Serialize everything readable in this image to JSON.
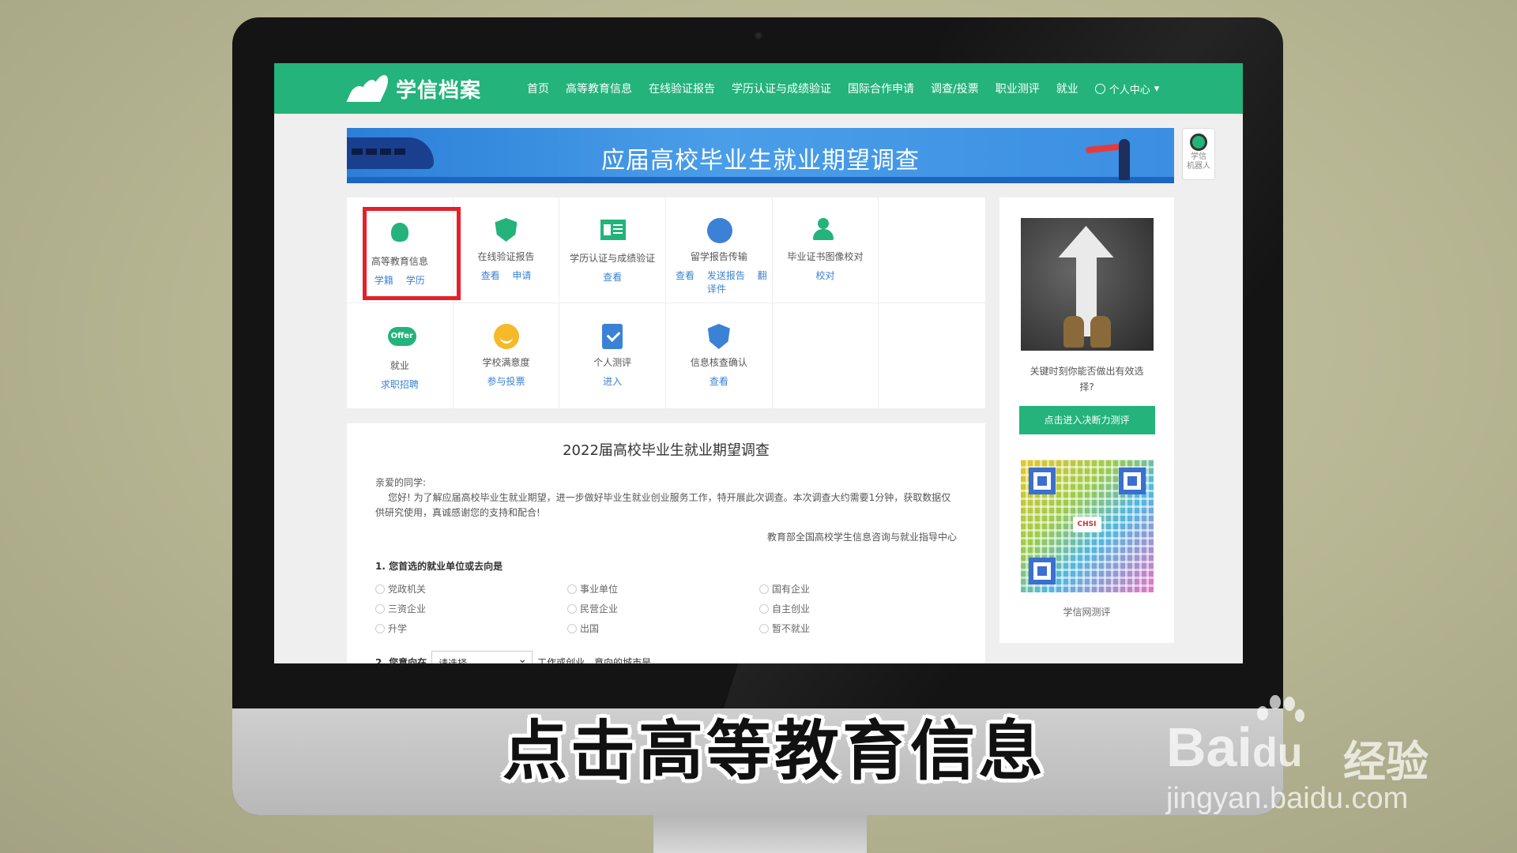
{
  "nav": {
    "logo_text": "学信档案",
    "items": [
      "首页",
      "高等教育信息",
      "在线验证报告",
      "学历认证与成绩验证",
      "国际合作申请",
      "调查/投票",
      "职业测评",
      "就业"
    ],
    "user_menu": "个人中心"
  },
  "banner": {
    "title": "应届高校毕业生就业期望调查"
  },
  "robot": {
    "label_line1": "学信",
    "label_line2": "机器人"
  },
  "services": [
    {
      "name": "高等教育信息",
      "links": [
        "学籍",
        "学历"
      ],
      "icon": "graduate-icon"
    },
    {
      "name": "在线验证报告",
      "links": [
        "查看",
        "申请"
      ],
      "icon": "shield-check-icon"
    },
    {
      "name": "学历认证与成绩验证",
      "links": [
        "查看"
      ],
      "icon": "id-card-icon"
    },
    {
      "name": "留学报告传输",
      "links": [
        "查看",
        "发送报告",
        "翻译件"
      ],
      "icon": "globe-icon"
    },
    {
      "name": "毕业证书图像校对",
      "links": [
        "校对"
      ],
      "icon": "user-check-icon"
    },
    {
      "name": "就业",
      "links": [
        "求职招聘"
      ],
      "icon": "offer-icon"
    },
    {
      "name": "学校满意度",
      "links": [
        "参与投票"
      ],
      "icon": "smile-icon"
    },
    {
      "name": "个人测评",
      "links": [
        "进入"
      ],
      "icon": "clipboard-check-icon"
    },
    {
      "name": "信息核查确认",
      "links": [
        "查看"
      ],
      "icon": "user-shield-icon"
    }
  ],
  "side": {
    "question": "关键时刻你能否做出有效选择?",
    "button": "点击进入决断力测评",
    "qr_center": "CHSI",
    "qr_label": "学信网测评"
  },
  "survey": {
    "title": "2022届高校毕业生就业期望调查",
    "greeting": "亲爱的同学:",
    "intro": "您好! 为了解应届高校毕业生就业期望，进一步做好毕业生就业创业服务工作，特开展此次调查。本次调查大约需要1分钟，获取数据仅供研究使用，真诚感谢您的支持和配合!",
    "org": "教育部全国高校学生信息咨询与就业指导中心",
    "q1": "1. 您首选的就业单位或去向是",
    "q1_options": [
      "党政机关",
      "事业单位",
      "国有企业",
      "三资企业",
      "民营企业",
      "自主创业",
      "升学",
      "出国",
      "暂不就业"
    ],
    "q2_prefix": "2. 您意向在",
    "q2_select": "请选择",
    "q2_suffix": "工作或创业，意向的城市是"
  },
  "caption": "点击高等教育信息",
  "watermark": {
    "brand": "Bai",
    "brand_suffix": "du",
    "cn": "经验",
    "url": "jingyan.baidu.com"
  },
  "colors": {
    "accent": "#23b37b",
    "link": "#3b82d6",
    "highlight": "#e5202a"
  }
}
